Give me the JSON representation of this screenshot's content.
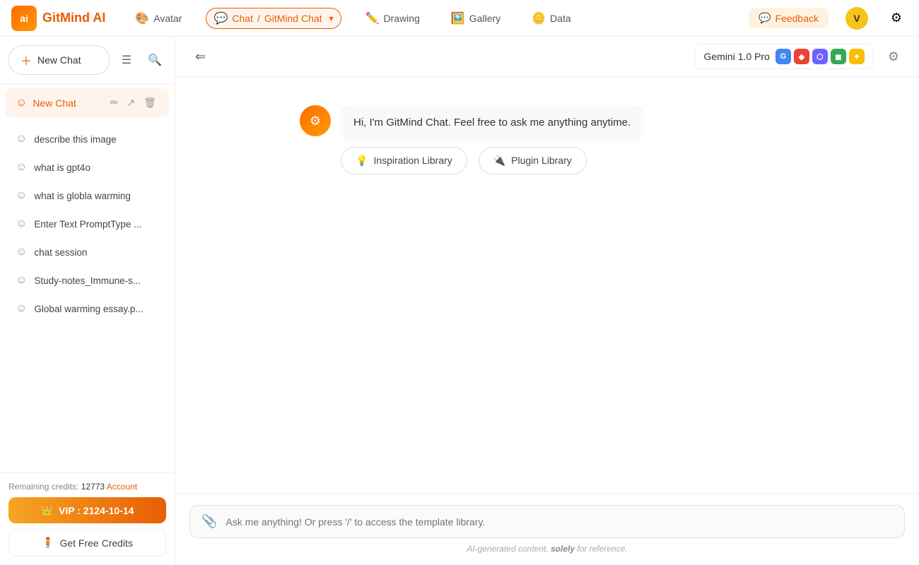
{
  "app": {
    "name": "GitMind AI"
  },
  "topnav": {
    "avatar_item": "Avatar",
    "chat_label": "Chat",
    "chat_sub": "GitMind Chat",
    "drawing_label": "Drawing",
    "gallery_label": "Gallery",
    "data_label": "Data",
    "feedback_label": "Feedback",
    "user_initial": "V"
  },
  "sidebar": {
    "new_chat_label": "New Chat",
    "active_chat_label": "New Chat",
    "chat_items": [
      {
        "label": "describe this image"
      },
      {
        "label": "what is gpt4o"
      },
      {
        "label": "what is globla warming"
      },
      {
        "label": "Enter Text PromptType ..."
      },
      {
        "label": "chat session"
      },
      {
        "label": "Study-notes_Immune-s..."
      },
      {
        "label": "Global warming essay.p..."
      }
    ],
    "credits_prefix": "Remaining credits: ",
    "credits_amount": "12773",
    "credits_link": "Account",
    "vip_label": "VIP : 2124-10-14",
    "free_credits_label": "Get Free Credits"
  },
  "chat": {
    "collapse_icon": "☰",
    "model_name": "Gemini 1.0 Pro",
    "model_icons": [
      {
        "bg": "#4285f4",
        "text": "G"
      },
      {
        "bg": "#ea4335",
        "text": "◆"
      },
      {
        "bg": "#6c63ff",
        "text": "⬡"
      },
      {
        "bg": "#34a853",
        "text": "◼"
      },
      {
        "bg": "#fbbc05",
        "text": "✦"
      }
    ],
    "welcome_message": "Hi, I'm GitMind Chat. Feel free to ask me anything anytime.",
    "inspiration_btn": "Inspiration Library",
    "plugin_btn": "Plugin Library",
    "input_placeholder": "Ask me anything! Or press '/' to access the template library.",
    "disclaimer": "AI-generated content, solely for reference."
  }
}
